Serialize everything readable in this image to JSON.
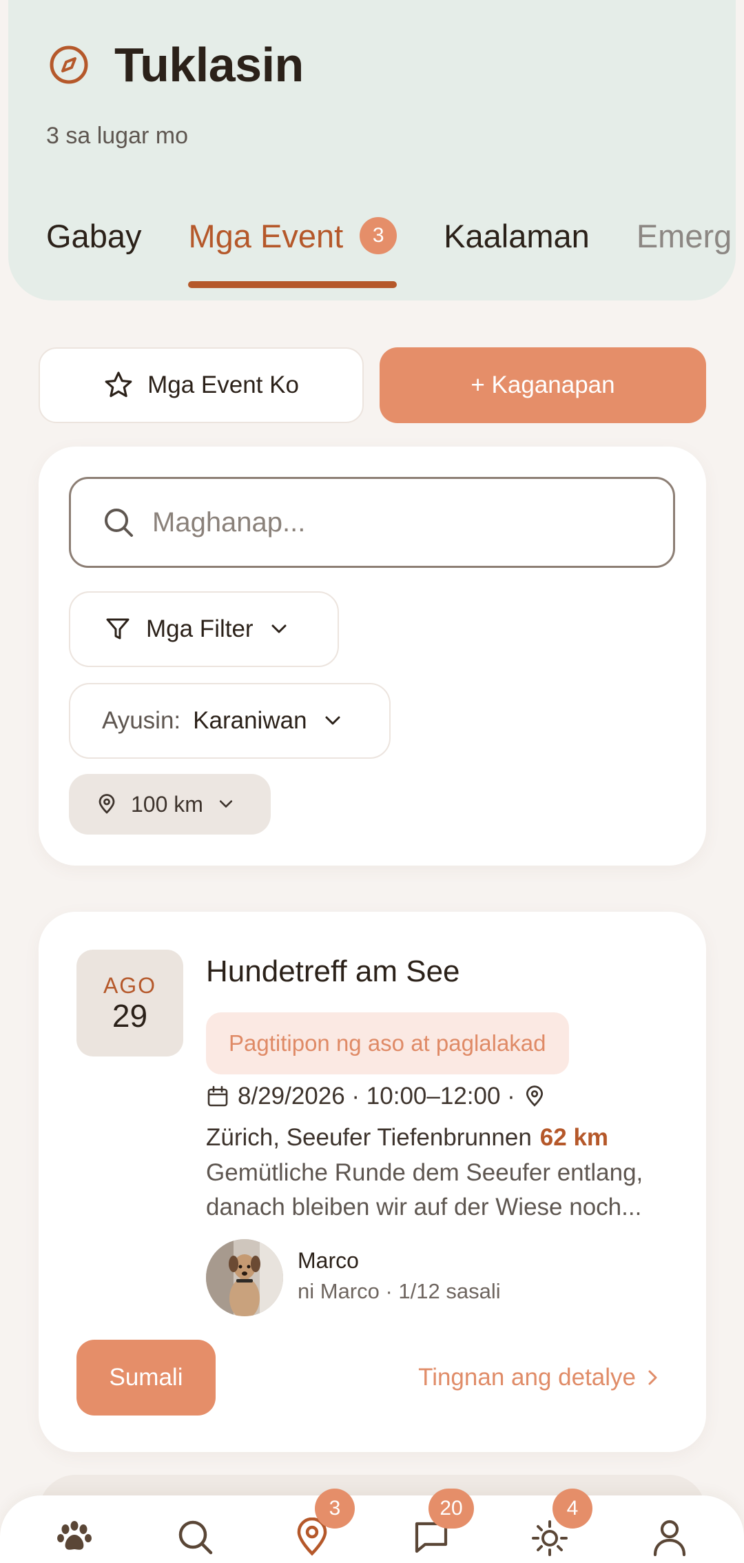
{
  "header": {
    "title": "Tuklasin",
    "subtitle": "3 sa lugar mo",
    "tabs": [
      {
        "label": "Gabay"
      },
      {
        "label": "Mga Event",
        "badge": "3",
        "active": true
      },
      {
        "label": "Kaalaman"
      },
      {
        "label": "Emerg"
      }
    ]
  },
  "actions": {
    "my_events_label": "Mga Event Ko",
    "add_event_label": "+ Kaganapan"
  },
  "filters": {
    "search_placeholder": "Maghanap...",
    "filter_label": "Mga Filter",
    "sort_prefix": "Ayusin:",
    "sort_value": "Karaniwan",
    "radius_label": "100 km"
  },
  "event": {
    "month": "AGO",
    "day": "29",
    "title": "Hundetreff am See",
    "tag": "Pagtitipon ng aso at paglalakad",
    "datetime": "8/29/2026 · 10:00–12:00 ·",
    "location": "Zürich, Seeufer Tiefenbrunnen",
    "distance": "62 km",
    "description_line1": "Gemütliche Runde dem Seeufer entlang,",
    "description_line2": "danach bleiben wir auf der Wiese noch...",
    "organizer_name": "Marco",
    "organizer_sub": "ni Marco · 1/12 sasali",
    "join_label": "Sumali",
    "details_label": "Tingnan ang detalye"
  },
  "bottom_nav": {
    "items": [
      {
        "icon": "paw-icon"
      },
      {
        "icon": "search-icon"
      },
      {
        "icon": "location-pin-icon",
        "badge": "3"
      },
      {
        "icon": "chat-icon",
        "badge": "20"
      },
      {
        "icon": "sun-icon",
        "badge": "4"
      },
      {
        "icon": "user-icon"
      }
    ]
  },
  "colors": {
    "accent": "#e58e69",
    "accent_dark": "#b5582a",
    "header_bg": "#e5ede8",
    "page_bg": "#f7f3f0"
  }
}
